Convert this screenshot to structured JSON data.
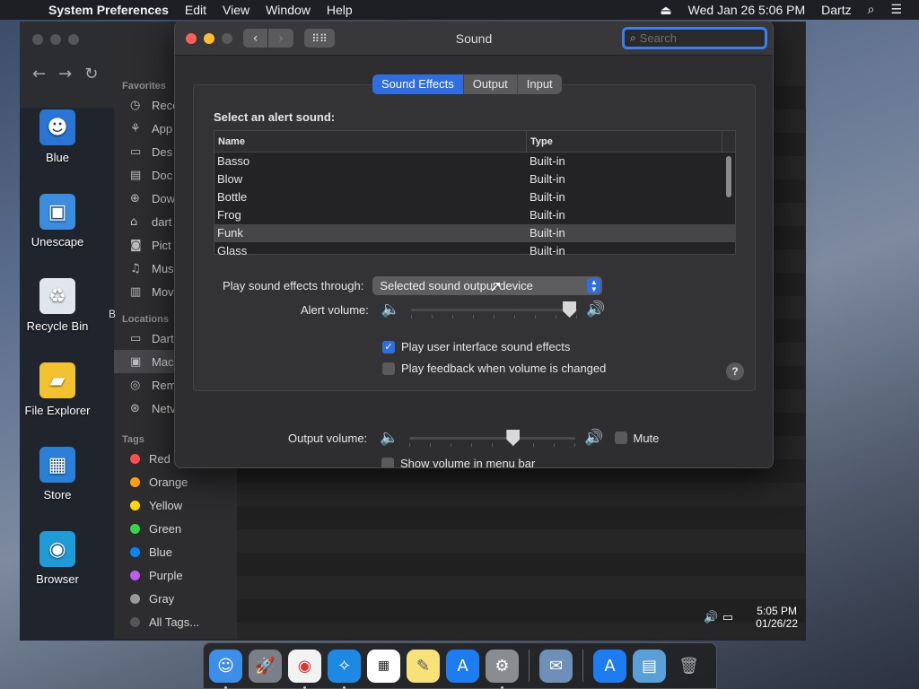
{
  "menubar": {
    "app_name": "System Preferences",
    "menus": [
      "Edit",
      "View",
      "Window",
      "Help"
    ],
    "clock": "Wed Jan 26  5:06 PM",
    "user": "Dartz"
  },
  "vm": {
    "desktop_icons": [
      {
        "label": "Blue",
        "icon": "user-icon",
        "color": "#2a74d4"
      },
      {
        "label": "Unescape",
        "icon": "app-icon",
        "color": "#3c8de0"
      },
      {
        "label": "Recycle Bin",
        "icon": "recycle-bin-icon",
        "color": "#dfe6ee"
      },
      {
        "label": "File Explorer",
        "icon": "folder-icon",
        "color": "#f3c230"
      },
      {
        "label": "Store",
        "icon": "store-icon",
        "color": "#2a7fd6"
      },
      {
        "label": "Browser",
        "icon": "browser-icon",
        "color": "#1f9bd8"
      }
    ],
    "taskbar_time": "5:05 PM",
    "taskbar_date": "01/26/22"
  },
  "finder": {
    "favorites_header": "Favorites",
    "favorites": [
      {
        "label": "Rece",
        "icon": "clock-icon"
      },
      {
        "label": "App",
        "icon": "applications-icon"
      },
      {
        "label": "Des",
        "icon": "desktop-icon"
      },
      {
        "label": "Doc",
        "icon": "document-icon"
      },
      {
        "label": "Dow",
        "icon": "download-icon"
      },
      {
        "label": "dart",
        "icon": "home-icon"
      },
      {
        "label": "Pict",
        "icon": "camera-icon"
      },
      {
        "label": "Mus",
        "icon": "music-icon"
      },
      {
        "label": "Mov",
        "icon": "film-icon"
      }
    ],
    "locations_header": "Locations",
    "locations": [
      {
        "label": "Dart",
        "icon": "computer-icon",
        "selected": false
      },
      {
        "label": "Mac",
        "icon": "disk-icon",
        "selected": true
      },
      {
        "label": "Rem",
        "icon": "disc-icon",
        "selected": false
      },
      {
        "label": "Netv",
        "icon": "network-icon",
        "selected": false
      }
    ],
    "tags_header": "Tags",
    "tags": [
      {
        "label": "Red",
        "color": "#ff4f4f"
      },
      {
        "label": "Orange",
        "color": "#ff9f0a"
      },
      {
        "label": "Yellow",
        "color": "#ffd60a"
      },
      {
        "label": "Green",
        "color": "#32d74b"
      },
      {
        "label": "Blue",
        "color": "#0a84ff"
      },
      {
        "label": "Purple",
        "color": "#bf5af2"
      },
      {
        "label": "Gray",
        "color": "#98989d"
      },
      {
        "label": "All Tags...",
        "color": "#555558"
      }
    ],
    "partial_label": "B"
  },
  "window": {
    "title": "Sound",
    "search_placeholder": "Search",
    "tabs": [
      {
        "label": "Sound Effects",
        "active": true
      },
      {
        "label": "Output",
        "active": false
      },
      {
        "label": "Input",
        "active": false
      }
    ]
  },
  "sound_effects": {
    "heading": "Select an alert sound:",
    "columns": {
      "name": "Name",
      "type": "Type"
    },
    "rows": [
      {
        "name": "Basso",
        "type": "Built-in",
        "selected": false
      },
      {
        "name": "Blow",
        "type": "Built-in",
        "selected": false
      },
      {
        "name": "Bottle",
        "type": "Built-in",
        "selected": false
      },
      {
        "name": "Frog",
        "type": "Built-in",
        "selected": false
      },
      {
        "name": "Funk",
        "type": "Built-in",
        "selected": true
      },
      {
        "name": "Glass",
        "type": "Built-in",
        "selected": false
      }
    ],
    "play_through_label": "Play sound effects through:",
    "play_through_value": "Selected sound output device",
    "alert_volume_label": "Alert volume:",
    "alert_volume": 0.95,
    "ui_sounds_label": "Play user interface sound effects",
    "ui_sounds_checked": true,
    "feedback_label": "Play feedback when volume is changed",
    "feedback_checked": false,
    "help": "?"
  },
  "output": {
    "volume_label": "Output volume:",
    "volume": 0.62,
    "mute_label": "Mute",
    "mute_checked": false,
    "menubar_label": "Show volume in menu bar",
    "menubar_checked": false
  }
}
